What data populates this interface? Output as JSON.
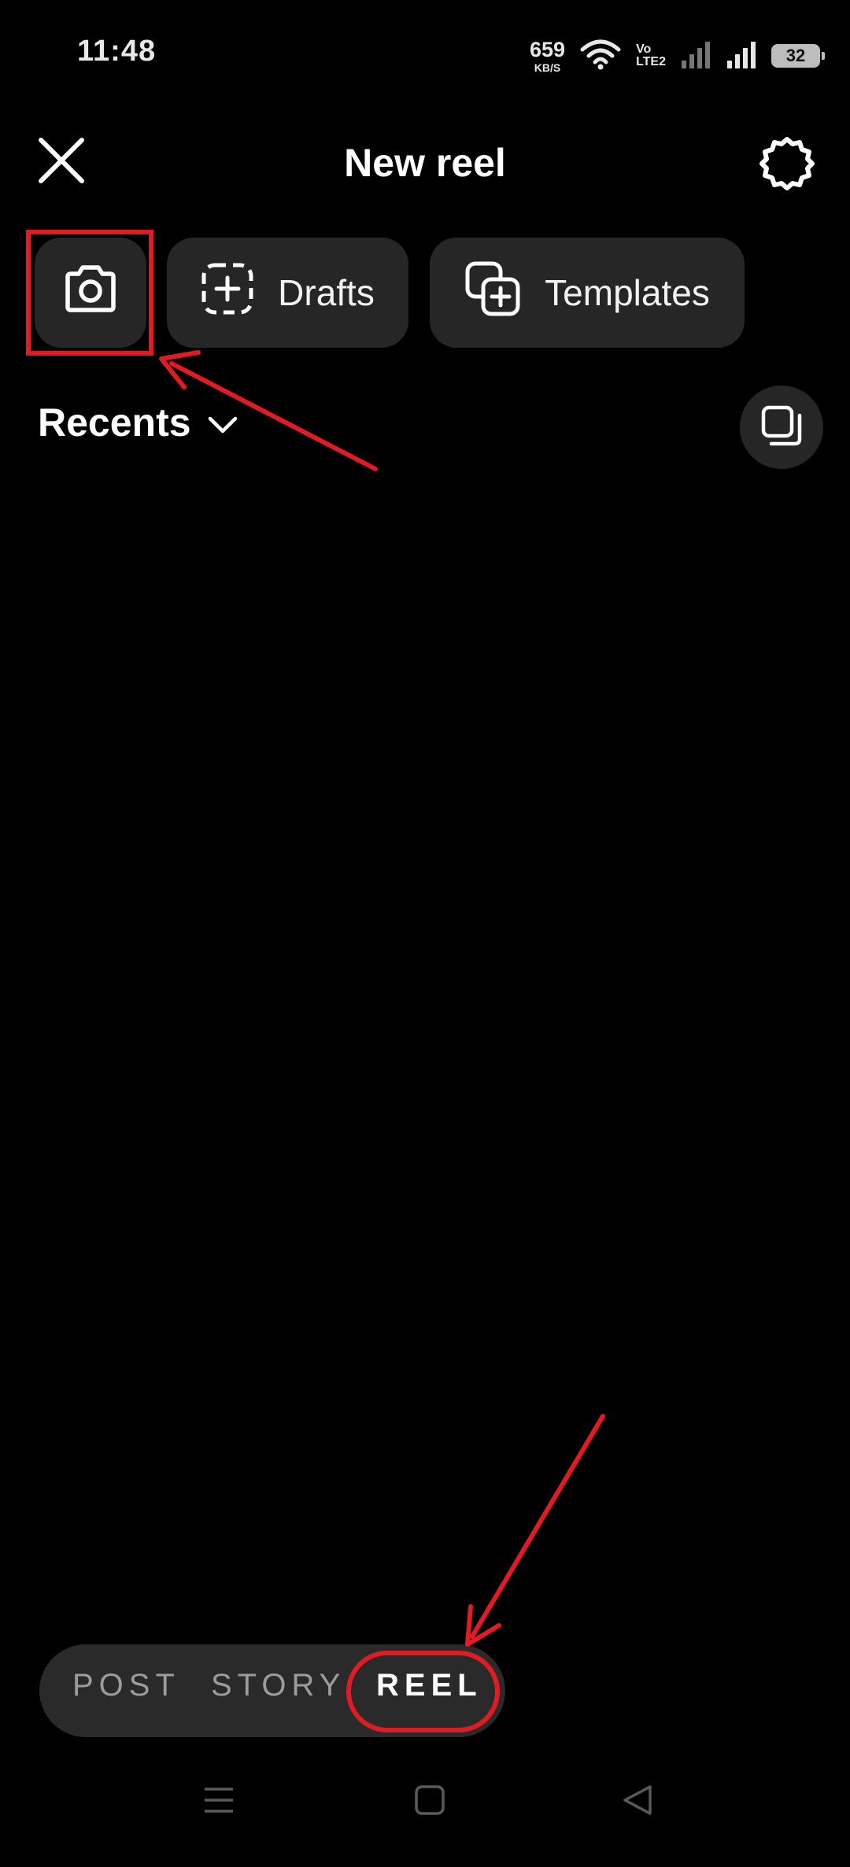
{
  "status_bar": {
    "time": "11:48",
    "speed_value": "659",
    "speed_unit": "KB/S",
    "volte_top": "Vo",
    "volte_bottom": "LTE2",
    "battery": "32"
  },
  "header": {
    "title": "New reel"
  },
  "chips": {
    "drafts_label": "Drafts",
    "templates_label": "Templates"
  },
  "gallery": {
    "album_label": "Recents"
  },
  "mode_switch": {
    "items": [
      "POST",
      "STORY",
      "REEL"
    ],
    "selected": "REEL"
  },
  "colors": {
    "background": "#000000",
    "chip_background": "#262626",
    "annotation_red": "#e01b24"
  },
  "icons": [
    "close-icon",
    "gear-icon",
    "camera-icon",
    "drafts-plus-icon",
    "templates-icon",
    "chevron-down-icon",
    "multi-select-icon"
  ]
}
